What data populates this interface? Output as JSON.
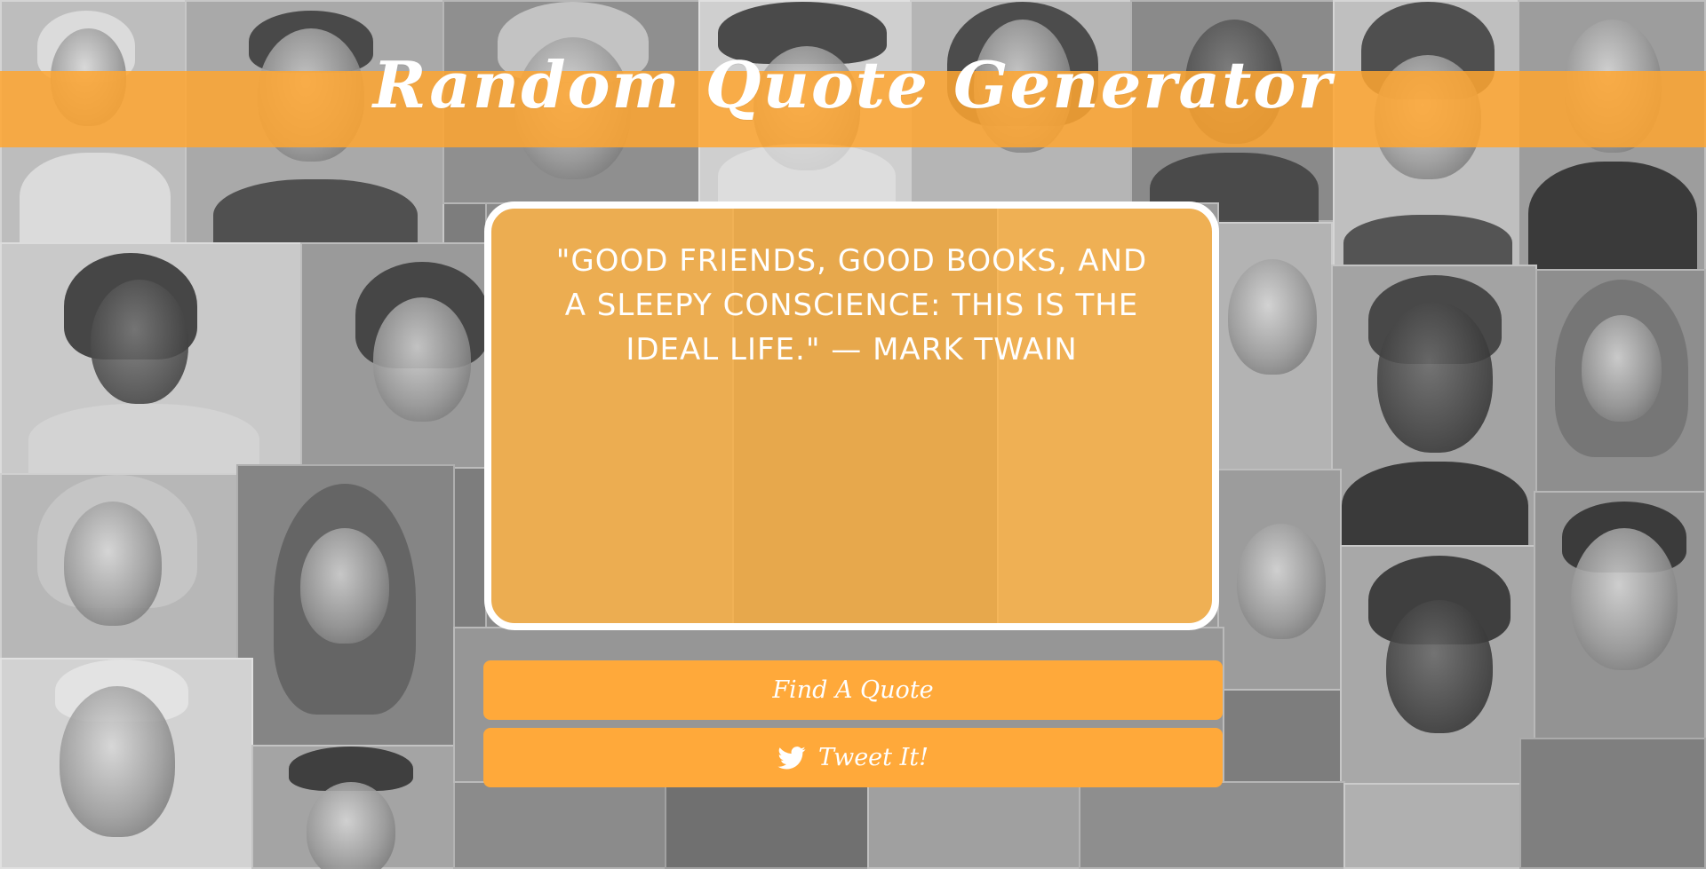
{
  "header": {
    "title": "Random Quote Generator"
  },
  "quote": {
    "text": "\"Good friends, good books, and a sleepy conscience: this is the ideal life.\" — Mark Twain"
  },
  "buttons": {
    "find_label": "Find A Quote",
    "tweet_label": "Tweet It!",
    "tweet_icon": "twitter-bird-icon"
  },
  "colors": {
    "accent": "#ffa93a",
    "card_background": "#ffb446",
    "text": "#ffffff"
  }
}
